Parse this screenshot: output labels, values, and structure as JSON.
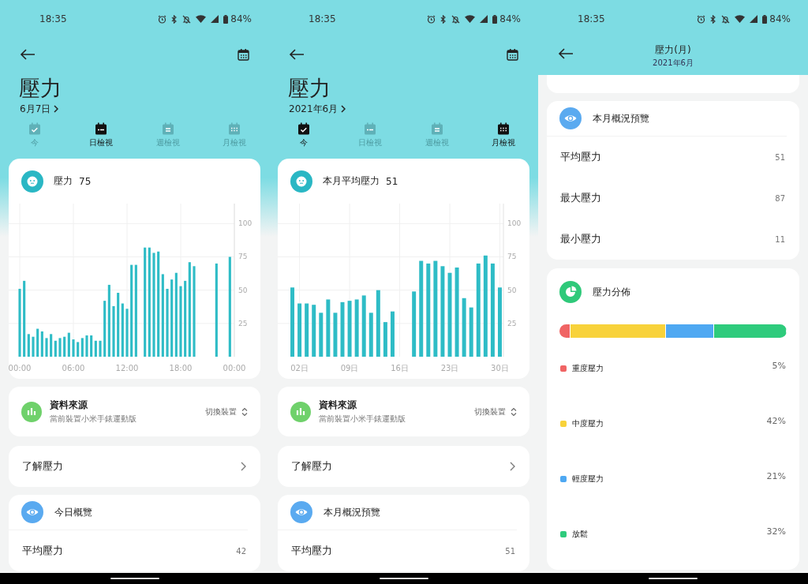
{
  "screens": [
    {
      "kind": "chart_view",
      "status_bar": {
        "time": "18:35",
        "battery": "84%"
      },
      "title": "壓力",
      "date": "6月7日",
      "tabs": [
        {
          "label": "今",
          "selected": false
        },
        {
          "label": "日檢視",
          "selected": true
        },
        {
          "label": "週檢視",
          "selected": false
        },
        {
          "label": "月檢視",
          "selected": false
        }
      ],
      "summary": {
        "label": "壓力",
        "value": "75",
        "chart_data": {
          "type": "bar",
          "grid": true,
          "x": [
            0,
            0.5,
            1,
            1.5,
            2,
            2.5,
            3,
            3.5,
            4,
            4.5,
            5,
            5.5,
            6,
            6.5,
            7,
            7.5,
            8,
            8.5,
            9,
            9.5,
            10,
            10.5,
            11,
            11.5,
            12,
            12.5,
            13,
            13.5,
            14,
            14.5,
            15,
            15.5,
            16,
            16.5,
            17,
            17.5,
            18,
            18.5,
            19,
            19.5,
            20,
            20.5,
            21,
            21.5,
            22,
            22.5,
            23,
            23.5
          ],
          "xlim": [
            0,
            24
          ],
          "values": [
            51,
            57,
            17,
            15,
            21,
            19,
            14,
            17,
            12,
            14,
            15,
            18,
            13,
            11,
            14,
            16,
            16,
            12,
            12,
            42,
            54,
            38,
            48,
            40,
            36,
            69,
            69,
            null,
            82,
            82,
            78,
            79,
            62,
            51,
            58,
            63,
            53,
            57,
            71,
            68,
            null,
            null,
            null,
            null,
            70,
            null,
            null,
            75
          ],
          "ylim": [
            0,
            115
          ],
          "yticks": [
            25,
            50,
            75,
            100
          ],
          "xticks": [
            {
              "value": 0,
              "label": "00:00"
            },
            {
              "value": 6,
              "label": "06:00"
            },
            {
              "value": 12,
              "label": "12:00"
            },
            {
              "value": 18,
              "label": "18:00"
            },
            {
              "value": 24,
              "label": "00:00"
            }
          ]
        }
      },
      "data_source": {
        "title": "資料來源",
        "subtitle": "當前裝置小米手錶運動版",
        "action": "切換裝置"
      },
      "learn": {
        "label": "了解壓力"
      },
      "overview": {
        "title": "今日概覽",
        "rows": [
          {
            "label": "平均壓力",
            "value": "42"
          }
        ]
      }
    },
    {
      "kind": "chart_view",
      "status_bar": {
        "time": "18:35",
        "battery": "84%"
      },
      "title": "壓力",
      "date": "2021年6月",
      "tabs": [
        {
          "label": "今",
          "selected": true
        },
        {
          "label": "日檢視",
          "selected": false
        },
        {
          "label": "週檢視",
          "selected": false
        },
        {
          "label": "月檢視",
          "selected": true
        }
      ],
      "summary": {
        "label": "本月平均壓力",
        "value": "51",
        "chart_data": {
          "type": "bar",
          "grid": true,
          "x": [
            1,
            2,
            3,
            4,
            5,
            6,
            7,
            8,
            9,
            10,
            11,
            12,
            13,
            14,
            15,
            16,
            17,
            18,
            19,
            20,
            21,
            22,
            23,
            24,
            25,
            26,
            27,
            28,
            29,
            30
          ],
          "xlim": [
            0.5,
            30.5
          ],
          "values": [
            52,
            40,
            40,
            39,
            33,
            43,
            33,
            41,
            42,
            43,
            46,
            33,
            50,
            26,
            34,
            null,
            null,
            49,
            72,
            70,
            72,
            68,
            63,
            67,
            44,
            37,
            70,
            76,
            70,
            52
          ],
          "ylim": [
            0,
            115
          ],
          "yticks": [
            25,
            50,
            75,
            100
          ],
          "xticks": [
            {
              "value": 2,
              "label": "02日"
            },
            {
              "value": 9,
              "label": "09日"
            },
            {
              "value": 16,
              "label": "16日"
            },
            {
              "value": 23,
              "label": "23日"
            },
            {
              "value": 30,
              "label": "30日"
            }
          ]
        }
      },
      "data_source": {
        "title": "資料來源",
        "subtitle": "當前裝置小米手錶運動版",
        "action": "切換裝置"
      },
      "learn": {
        "label": "了解壓力"
      },
      "overview": {
        "title": "本月概況預覽",
        "rows": [
          {
            "label": "平均壓力",
            "value": "51"
          }
        ]
      }
    },
    {
      "kind": "detail",
      "status_bar": {
        "time": "18:35",
        "battery": "84%"
      },
      "header": {
        "title": "壓力(月)",
        "subtitle": "2021年6月"
      },
      "overview": {
        "title": "本月概況預覽",
        "rows": [
          {
            "label": "平均壓力",
            "value": "51"
          },
          {
            "label": "最大壓力",
            "value": "87"
          },
          {
            "label": "最小壓力",
            "value": "11"
          }
        ]
      },
      "distribution": {
        "title": "壓力分佈",
        "items": [
          {
            "label": "重度壓力",
            "percent": "5%",
            "color": "#f06464"
          },
          {
            "label": "中度壓力",
            "percent": "42%",
            "color": "#f8d23a"
          },
          {
            "label": "輕度壓力",
            "percent": "21%",
            "color": "#4ea8f2"
          },
          {
            "label": "放鬆",
            "percent": "32%",
            "color": "#2ecb7c"
          }
        ]
      }
    }
  ]
}
